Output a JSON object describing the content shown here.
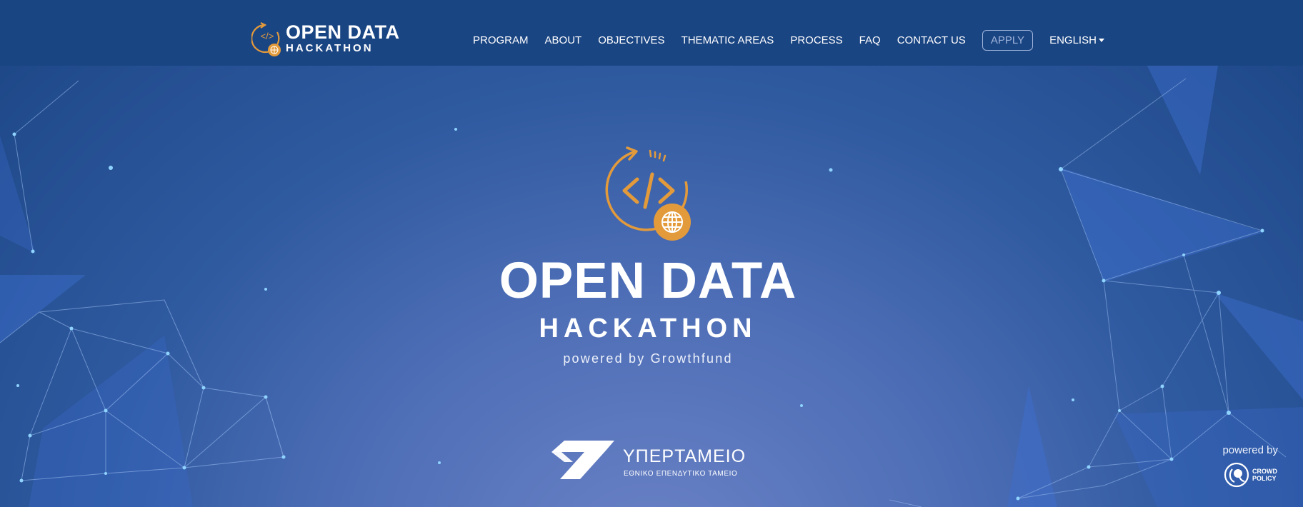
{
  "brand": {
    "line1": "OPEN DATA",
    "line2": "HACKATHON",
    "logo_icon": "code-globe-icon"
  },
  "nav": {
    "items": [
      {
        "label": "PROGRAM"
      },
      {
        "label": "ABOUT"
      },
      {
        "label": "OBJECTIVES"
      },
      {
        "label": "THEMATIC AREAS"
      },
      {
        "label": "PROCESS"
      },
      {
        "label": "FAQ"
      },
      {
        "label": "CONTACT US"
      }
    ],
    "apply_label": "APPLY",
    "language_label": "ENGLISH"
  },
  "hero": {
    "title": "OPEN DATA",
    "subtitle": "HACKATHON",
    "powered": "powered by Growthfund"
  },
  "sponsor": {
    "name": "ΥΠΕΡΤΑΜΕΙΟ",
    "tagline": "ΕΘΝΙΚΟ ΕΠΕΝΔΥΤΙΚΟ ΤΑΜΕΙΟ"
  },
  "footer": {
    "powered_by_label": "powered by",
    "partner_line1": "CROWD",
    "partner_line2": "POLICY"
  },
  "colors": {
    "navbar": "#1a4583",
    "accent_orange": "#e39a3b",
    "apply_border": "#9fb4da"
  }
}
